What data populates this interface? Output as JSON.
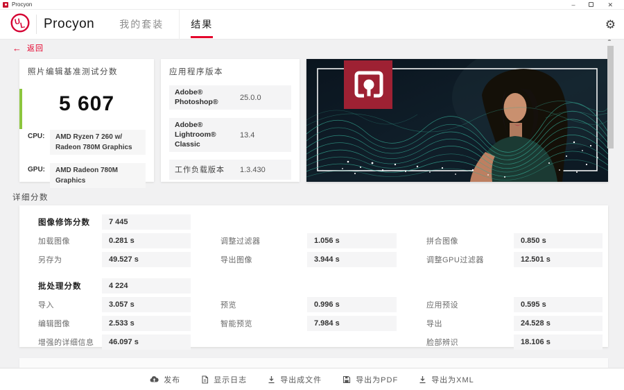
{
  "window": {
    "title": "Procyon"
  },
  "nav": {
    "brand": "Procyon",
    "tabs": [
      {
        "label": "我的套装",
        "active": false
      },
      {
        "label": "结果",
        "active": true
      }
    ]
  },
  "back_label": "返回",
  "score_card": {
    "title": "照片编辑基准测试分数",
    "score": "5 607",
    "cpu_label": "CPU:",
    "cpu": "AMD Ryzen 7 260 w/ Radeon 780M Graphics",
    "gpu_label": "GPU:",
    "gpu": "AMD Radeon 780M Graphics"
  },
  "versions_card": {
    "title": "应用程序版本",
    "rows": [
      {
        "label": "Adobe® Photoshop®",
        "value": "25.0.0"
      },
      {
        "label": "Adobe® Lightroom® Classic",
        "value": "13.4"
      },
      {
        "label": "工作负载版本",
        "value": "1.3.430"
      }
    ]
  },
  "details": {
    "section_title": "详细分数",
    "retouch": {
      "score_label": "图像修饰分数",
      "score": "7 445",
      "cells": [
        {
          "label": "加载图像",
          "value": "0.281 s"
        },
        {
          "label": "调整过滤器",
          "value": "1.056 s"
        },
        {
          "label": "拼合图像",
          "value": "0.850 s"
        },
        {
          "label": "另存为",
          "value": "49.527 s"
        },
        {
          "label": "导出图像",
          "value": "3.944 s"
        },
        {
          "label": "调整GPU过滤器",
          "value": "12.501 s"
        }
      ]
    },
    "batch": {
      "score_label": "批处理分数",
      "score": "4 224",
      "cells": [
        {
          "label": "导入",
          "value": "3.057 s"
        },
        {
          "label": "预览",
          "value": "0.996 s"
        },
        {
          "label": "应用预设",
          "value": "0.595 s"
        },
        {
          "label": "编辑图像",
          "value": "2.533 s"
        },
        {
          "label": "智能预览",
          "value": "7.984 s"
        },
        {
          "label": "导出",
          "value": "24.528 s"
        },
        {
          "label": "增强的详细信息",
          "value": "46.097 s"
        },
        {
          "label": "脸部辨识",
          "value": "18.106 s"
        }
      ]
    }
  },
  "footer": {
    "buttons": [
      {
        "icon": "cloud-upload",
        "label": "发布"
      },
      {
        "icon": "log-document",
        "label": "显示日志"
      },
      {
        "icon": "download-file",
        "label": "导出成文件"
      },
      {
        "icon": "save-disk",
        "label": "导出为PDF"
      },
      {
        "icon": "download-xml",
        "label": "导出为XML"
      }
    ]
  },
  "colors": {
    "accent": "#e4002b",
    "green_bar": "#8cc63e",
    "hero_red": "#9e2133"
  }
}
